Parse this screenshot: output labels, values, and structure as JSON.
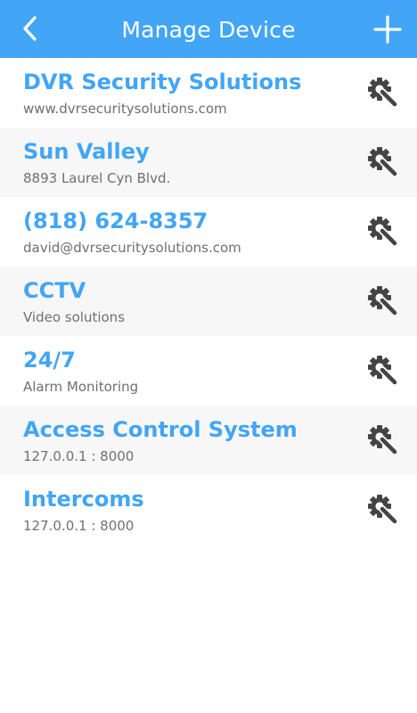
{
  "header": {
    "title": "Manage Device",
    "back_icon": "chevron-left-icon",
    "add_icon": "plus-icon",
    "background": "#42a5f5",
    "text_color": "#ffffff"
  },
  "devices": [
    {
      "name": "DVR Security Solutions",
      "subtitle": "www.dvrsecuritysolutions.com"
    },
    {
      "name": "Sun Valley",
      "subtitle": "8893 Laurel Cyn Blvd."
    },
    {
      "name": "(818) 624-8357",
      "subtitle": "david@dvrsecuritysolutions.com"
    },
    {
      "name": "CCTV",
      "subtitle": "Video solutions"
    },
    {
      "name": "24/7",
      "subtitle": "Alarm Monitoring"
    },
    {
      "name": "Access Control System",
      "subtitle": "127.0.0.1 : 8000"
    },
    {
      "name": "Intercoms",
      "subtitle": "127.0.0.1 : 8000"
    }
  ],
  "row_settings_icon": "gear-wrench-icon",
  "colors": {
    "accent": "#42a5f5",
    "subtitle": "#6f6f6f",
    "row_alt": "#f7f7f7",
    "icon": "#444444"
  }
}
